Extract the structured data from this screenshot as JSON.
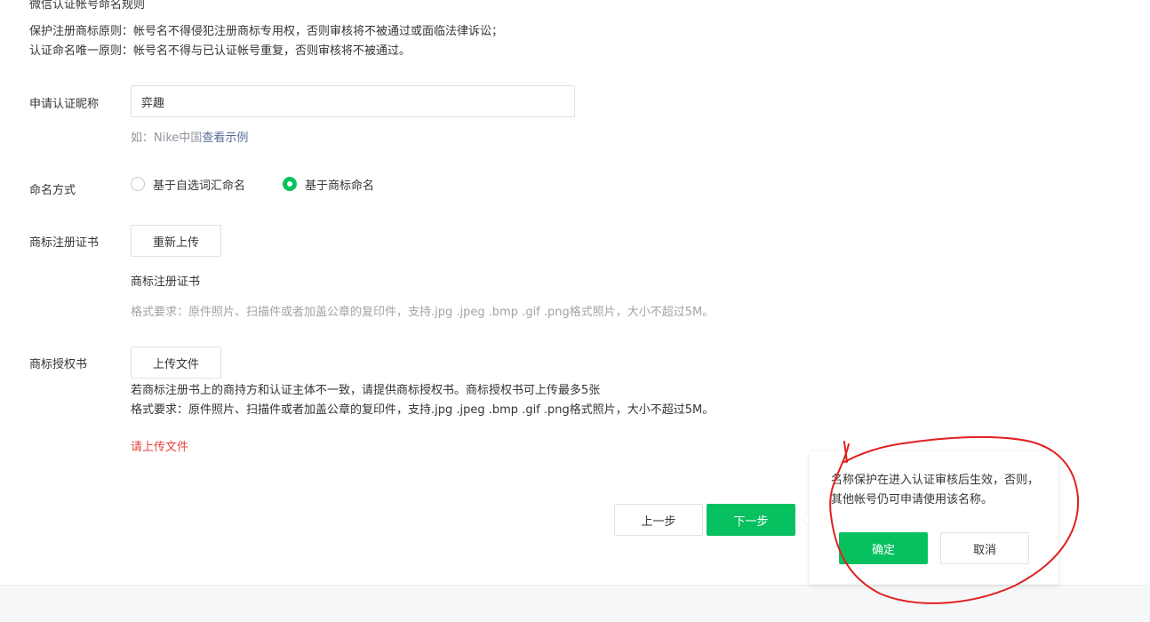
{
  "rules": {
    "title": "微信认证帐号命名规则",
    "line1": "保护注册商标原则：帐号名不得侵犯注册商标专用权，否则审核将不被通过或面临法律诉讼；",
    "line2": "认证命名唯一原则：帐号名不得与已认证帐号重复，否则审核将不被通过。"
  },
  "nickname": {
    "label": "申请认证昵称",
    "value": "弈趣",
    "hint_prefix": "如：Nike中国",
    "hint_link": "查看示例"
  },
  "naming": {
    "label": "命名方式",
    "options": [
      {
        "label": "基于自选词汇命名",
        "checked": false
      },
      {
        "label": "基于商标命名",
        "checked": true
      }
    ]
  },
  "trademark_cert": {
    "label": "商标注册证书",
    "button": "重新上传",
    "file_name": "商标注册证书",
    "format": "格式要求：原件照片、扫描件或者加盖公章的复印件，支持.jpg .jpeg .bmp .gif .png格式照片，大小不超过5M。"
  },
  "trademark_auth": {
    "label": "商标授权书",
    "button": "上传文件",
    "desc": "若商标注册书上的商持方和认证主体不一致，请提供商标授权书。商标授权书可上传最多5张",
    "format": "格式要求：原件照片、扫描件或者加盖公章的复印件，支持.jpg .jpeg .bmp .gif .png格式照片，大小不超过5M。",
    "error": "请上传文件"
  },
  "footer": {
    "prev": "上一步",
    "next": "下一步"
  },
  "popover": {
    "text": "名称保护在进入认证审核后生效，否则，其他帐号仍可申请使用该名称。",
    "confirm": "确定",
    "cancel": "取消"
  },
  "colors": {
    "primary": "#07c160",
    "error": "#e64340",
    "link": "#576b95",
    "annotation": "#e02020"
  }
}
